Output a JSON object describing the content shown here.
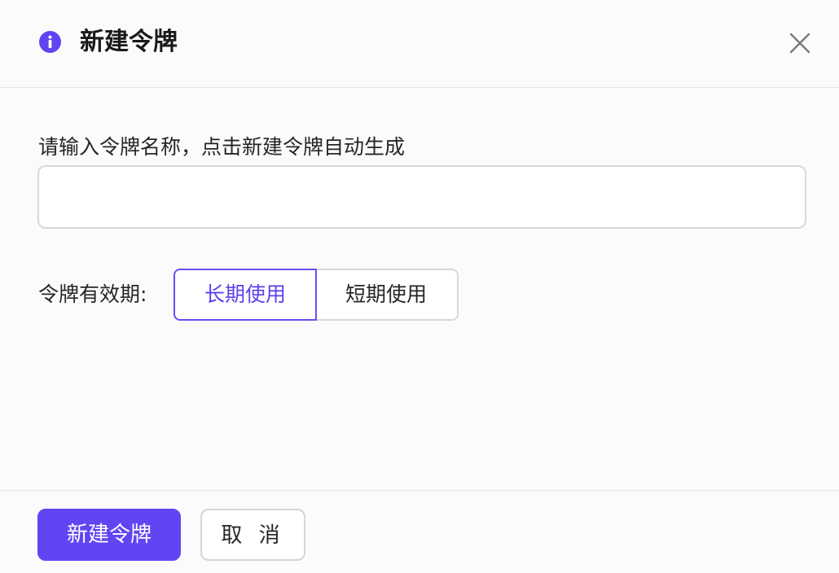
{
  "dialog": {
    "title": "新建令牌",
    "info_icon": "info-circle-icon",
    "close_icon": "close-icon"
  },
  "form": {
    "name_label": "请输入令牌名称，点击新建令牌自动生成",
    "name_value": "",
    "name_placeholder": "",
    "validity_label": "令牌有效期:",
    "validity_options": [
      {
        "label": "长期使用",
        "selected": true
      },
      {
        "label": "短期使用",
        "selected": false
      }
    ]
  },
  "footer": {
    "create_label": "新建令牌",
    "cancel_label": "取 消"
  },
  "colors": {
    "accent": "#6244f2",
    "border": "#d8d8dc",
    "background": "#fbfbfc"
  }
}
